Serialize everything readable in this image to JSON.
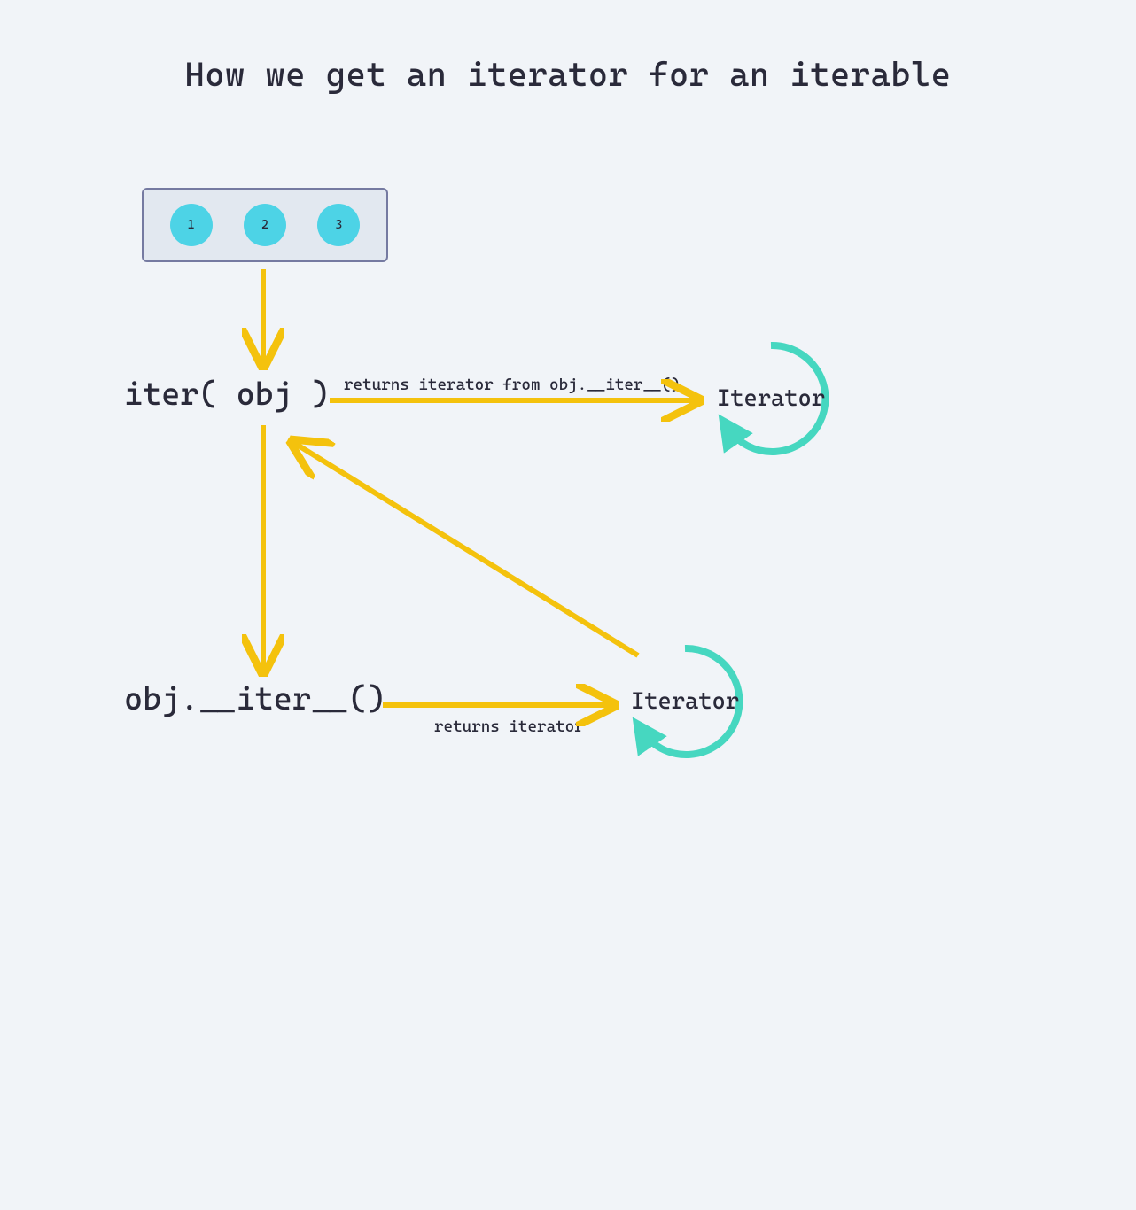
{
  "title": "How we get an iterator for an iterable",
  "iterable": {
    "items": [
      "1",
      "2",
      "3"
    ]
  },
  "nodes": {
    "iter_call": "iter( obj )",
    "dunder": "obj.__iter__()"
  },
  "iterator_label": "Iterator",
  "arrow_captions": {
    "a": "returns iterator from obj.__iter__()",
    "b": "returns iterator"
  },
  "colors": {
    "arrow": "#f4c20d",
    "iterator_ring": "#46d7c0",
    "ball": "#4dd3e6",
    "box_border": "#757aa1"
  }
}
